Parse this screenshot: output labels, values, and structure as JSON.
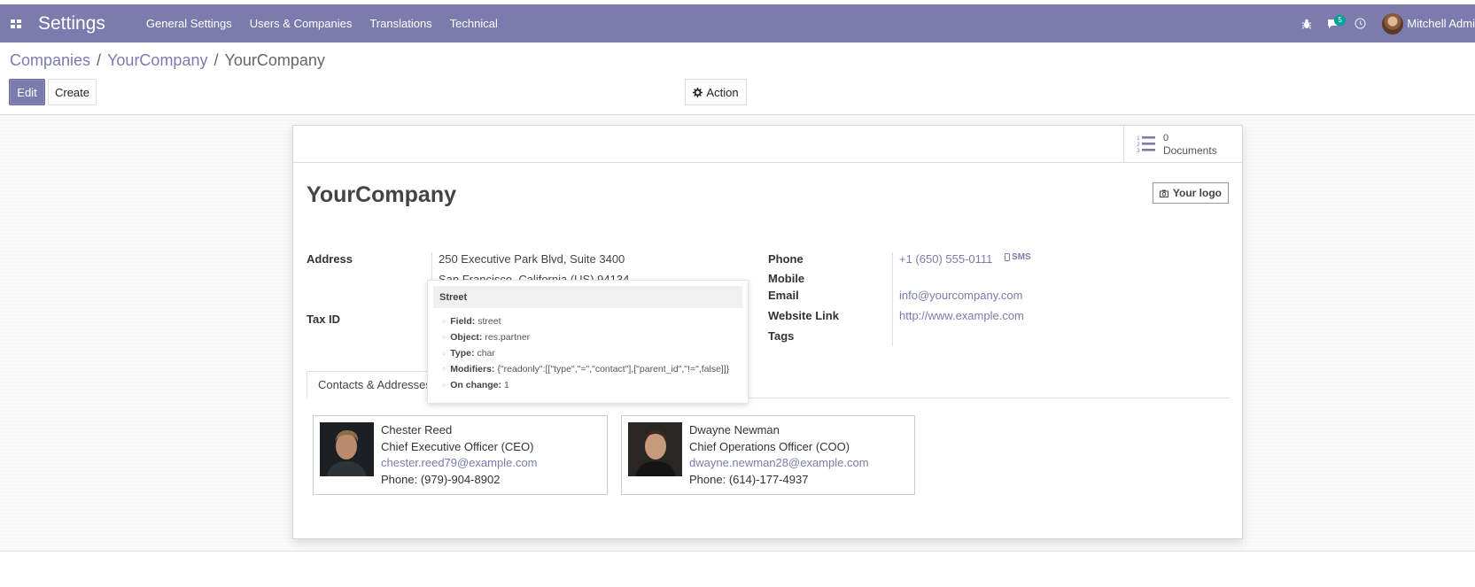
{
  "navbar": {
    "app_title": "Settings",
    "menu": [
      "General Settings",
      "Users & Companies",
      "Translations",
      "Technical"
    ],
    "messages_count": "5",
    "user_name": "Mitchell Admi"
  },
  "breadcrumb": [
    "Companies",
    "YourCompany",
    "YourCompany"
  ],
  "buttons": {
    "edit": "Edit",
    "create": "Create",
    "action": "Action"
  },
  "smart_button": {
    "count": "0",
    "label": "Documents"
  },
  "record": {
    "name": "YourCompany",
    "logo_button": "Your logo",
    "address_label": "Address",
    "street": "250 Executive Park Blvd, Suite 3400",
    "city_line": "San Francisco, California (US) 94134",
    "tax_id_label": "Tax ID",
    "phone_label": "Phone",
    "phone": "+1 (650) 555-0111",
    "sms_label": "SMS",
    "mobile_label": "Mobile",
    "email_label": "Email",
    "email": "info@yourcompany.com",
    "website_label": "Website Link",
    "website": "http://www.example.com",
    "tags_label": "Tags"
  },
  "tabs": [
    "Contacts & Addresses"
  ],
  "contacts": [
    {
      "name": "Chester Reed",
      "title": "Chief Executive Officer (CEO)",
      "email": "chester.reed79@example.com",
      "phone": "Phone: (979)-904-8902"
    },
    {
      "name": "Dwayne Newman",
      "title": "Chief Operations Officer (COO)",
      "email": "dwayne.newman28@example.com",
      "phone": "Phone: (614)-177-4937"
    }
  ],
  "tooltip": {
    "title": "Street",
    "rows": [
      {
        "key": "Field:",
        "value": "street"
      },
      {
        "key": "Object:",
        "value": "res.partner"
      },
      {
        "key": "Type:",
        "value": "char"
      },
      {
        "key": "Modifiers:",
        "value": "{\"readonly\":[[\"type\",\"=\",\"contact\"],[\"parent_id\",\"!=\",false]]}"
      },
      {
        "key": "On change:",
        "value": "1"
      }
    ]
  },
  "colors": {
    "brand": "#7c7bad",
    "badge": "#00a09d"
  },
  "icons": [
    "apps-icon",
    "bug-icon",
    "chat-icon",
    "clock-icon",
    "gear-icon",
    "list-numbered-icon",
    "camera-icon",
    "mobile-icon"
  ]
}
